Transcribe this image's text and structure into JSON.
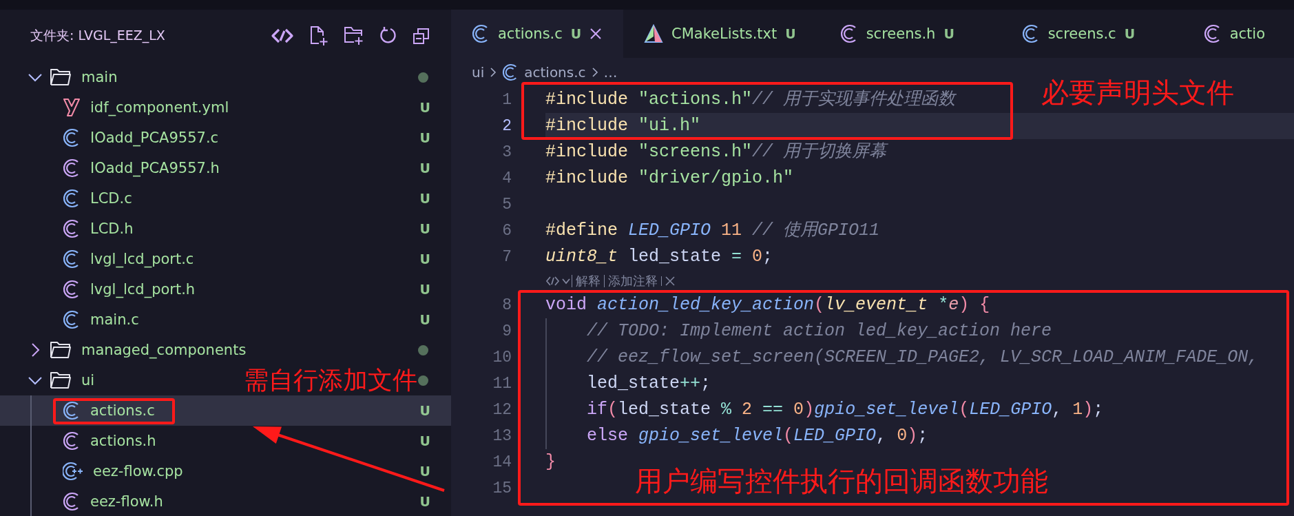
{
  "explorer": {
    "title": "文件夹: LVGL_EEZ_LX",
    "tree": [
      {
        "label": "main",
        "kind": "folder",
        "expanded": true,
        "modified": true,
        "selected": false,
        "children": [
          {
            "label": "idf_component.yml",
            "kind": "yml",
            "status": "U",
            "selected": false
          },
          {
            "label": "IOadd_PCA9557.c",
            "kind": "c",
            "status": "U",
            "selected": false
          },
          {
            "label": "IOadd_PCA9557.h",
            "kind": "h",
            "status": "U",
            "selected": false
          },
          {
            "label": "LCD.c",
            "kind": "c",
            "status": "U",
            "selected": false
          },
          {
            "label": "LCD.h",
            "kind": "h",
            "status": "U",
            "selected": false
          },
          {
            "label": "lvgl_lcd_port.c",
            "kind": "c",
            "status": "U",
            "selected": false
          },
          {
            "label": "lvgl_lcd_port.h",
            "kind": "h",
            "status": "U",
            "selected": false
          },
          {
            "label": "main.c",
            "kind": "c",
            "status": "U",
            "selected": false
          }
        ]
      },
      {
        "label": "managed_components",
        "kind": "folder",
        "expanded": false,
        "modified": true,
        "selected": false
      },
      {
        "label": "ui",
        "kind": "folder",
        "expanded": true,
        "modified": true,
        "selected": false,
        "children": [
          {
            "label": "actions.c",
            "kind": "c",
            "status": "U",
            "selected": true
          },
          {
            "label": "actions.h",
            "kind": "h",
            "status": "U",
            "selected": false
          },
          {
            "label": "eez-flow.cpp",
            "kind": "cpp",
            "status": "U",
            "selected": false
          },
          {
            "label": "eez-flow.h",
            "kind": "h",
            "status": "U",
            "selected": false
          }
        ]
      }
    ]
  },
  "tabs": [
    {
      "label": "actions.c",
      "kind": "c",
      "status": "U",
      "selected": true
    },
    {
      "label": "CMakeLists.txt",
      "kind": "cmake",
      "status": "U",
      "selected": false
    },
    {
      "label": "screens.h",
      "kind": "h",
      "status": "U",
      "selected": false
    },
    {
      "label": "screens.c",
      "kind": "c",
      "status": "U",
      "selected": false
    },
    {
      "label": "actio",
      "kind": "h",
      "selected": false
    }
  ],
  "breadcrumb": [
    {
      "label": "ui",
      "kind": "folder"
    },
    {
      "label": "actions.c",
      "kind": "c"
    },
    {
      "label": "…",
      "kind": "more"
    }
  ],
  "code": [
    {
      "kind": "code",
      "number": "1",
      "current": false,
      "tokens": [
        {
          "kind": "pp",
          "text": "#include"
        },
        {
          "kind": "str",
          "text": " \"actions.h\""
        },
        {
          "kind": "cm",
          "text": "// 用于实现事件处理函数"
        }
      ]
    },
    {
      "kind": "code",
      "number": "2",
      "current": true,
      "tokens": [
        {
          "kind": "pp",
          "text": "#include"
        },
        {
          "kind": "str",
          "text": " \"ui.h\""
        }
      ]
    },
    {
      "kind": "code",
      "number": "3",
      "current": false,
      "tokens": [
        {
          "kind": "pp",
          "text": "#include"
        },
        {
          "kind": "str",
          "text": " \"screens.h\""
        },
        {
          "kind": "cm",
          "text": "// 用于切换屏幕"
        }
      ]
    },
    {
      "kind": "code",
      "number": "4",
      "current": false,
      "tokens": [
        {
          "kind": "pp",
          "text": "#include"
        },
        {
          "kind": "str",
          "text": " \"driver/gpio.h\""
        }
      ]
    },
    {
      "kind": "code",
      "number": "5",
      "current": false
    },
    {
      "kind": "code",
      "number": "6",
      "current": false,
      "tokens": [
        {
          "kind": "pp",
          "text": "#define"
        },
        {
          "kind": "macro",
          "text": " LED_GPIO"
        },
        {
          "kind": "num",
          "text": " 11"
        },
        {
          "kind": "cm",
          "text": " // 使用GPIO11"
        }
      ]
    },
    {
      "kind": "code",
      "number": "7",
      "current": false,
      "tokens": [
        {
          "kind": "ty",
          "text": "uint8_t"
        },
        {
          "kind": "plain",
          "text": " led_state "
        },
        {
          "kind": "op",
          "text": "="
        },
        {
          "kind": "num",
          "text": " 0"
        },
        {
          "kind": "plain",
          "text": ";"
        }
      ]
    },
    {
      "kind": "lens",
      "actions": [
        "解释",
        "添加注释"
      ]
    },
    {
      "kind": "code",
      "number": "8",
      "current": false,
      "tokens": [
        {
          "kind": "kw",
          "text": "void"
        },
        {
          "kind": "fn",
          "text": " action_led_key_action"
        },
        {
          "kind": "paren",
          "text": "("
        },
        {
          "kind": "ty",
          "text": "lv_event_t"
        },
        {
          "kind": "op",
          "text": " *"
        },
        {
          "kind": "param",
          "text": "e"
        },
        {
          "kind": "paren",
          "text": ") {"
        }
      ]
    },
    {
      "kind": "code",
      "number": "9",
      "current": false,
      "guide": true,
      "tokens": [
        {
          "kind": "cm",
          "text": "// TODO: Implement action led_key_action here"
        }
      ]
    },
    {
      "kind": "code",
      "number": "10",
      "current": false,
      "guide": true,
      "tokens": [
        {
          "kind": "cm",
          "text": "// eez_flow_set_screen(SCREEN_ID_PAGE2, LV_SCR_LOAD_ANIM_FADE_ON,"
        }
      ]
    },
    {
      "kind": "code",
      "number": "11",
      "current": false,
      "guide": true,
      "tokens": [
        {
          "kind": "plain",
          "text": "led_state"
        },
        {
          "kind": "op",
          "text": "++"
        },
        {
          "kind": "plain",
          "text": ";"
        }
      ]
    },
    {
      "kind": "code",
      "number": "12",
      "current": false,
      "guide": true,
      "tokens": [
        {
          "kind": "kw",
          "text": "if"
        },
        {
          "kind": "paren",
          "text": "("
        },
        {
          "kind": "plain",
          "text": "led_state "
        },
        {
          "kind": "op",
          "text": "%"
        },
        {
          "kind": "num",
          "text": " 2 "
        },
        {
          "kind": "op",
          "text": "=="
        },
        {
          "kind": "num",
          "text": " 0"
        },
        {
          "kind": "paren",
          "text": ")"
        },
        {
          "kind": "fn",
          "text": "gpio_set_level"
        },
        {
          "kind": "paren",
          "text": "("
        },
        {
          "kind": "macro",
          "text": "LED_GPIO"
        },
        {
          "kind": "plain",
          "text": ", "
        },
        {
          "kind": "num",
          "text": "1"
        },
        {
          "kind": "paren",
          "text": ")"
        },
        {
          "kind": "plain",
          "text": ";"
        }
      ]
    },
    {
      "kind": "code",
      "number": "13",
      "current": false,
      "guide": true,
      "tokens": [
        {
          "kind": "kw",
          "text": "else"
        },
        {
          "kind": "fn",
          "text": " gpio_set_level"
        },
        {
          "kind": "paren",
          "text": "("
        },
        {
          "kind": "macro",
          "text": "LED_GPIO"
        },
        {
          "kind": "plain",
          "text": ", "
        },
        {
          "kind": "num",
          "text": "0"
        },
        {
          "kind": "paren",
          "text": ")"
        },
        {
          "kind": "plain",
          "text": ";"
        }
      ]
    },
    {
      "kind": "code",
      "number": "14",
      "current": false,
      "tokens": [
        {
          "kind": "paren",
          "text": "}"
        }
      ]
    },
    {
      "kind": "code",
      "number": "15",
      "current": false
    }
  ],
  "annotations": [
    {
      "text": "必要声明头文件"
    },
    {
      "text": "需自行添加文件"
    },
    {
      "text": "用户编写控件执行的回调函数功能"
    }
  ]
}
